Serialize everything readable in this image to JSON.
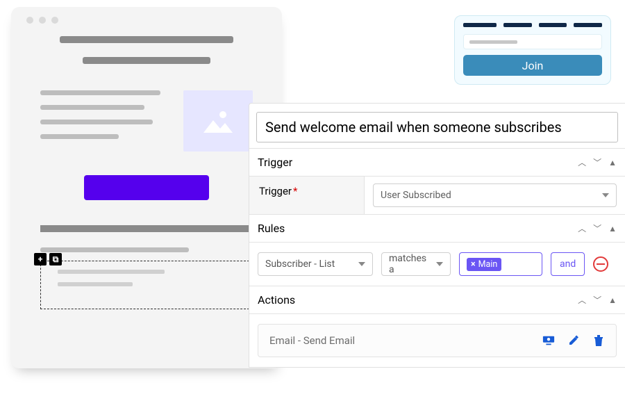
{
  "join_widget": {
    "button_label": "Join"
  },
  "automation": {
    "title_value": "Send welcome email when someone subscribes",
    "trigger_section": {
      "heading": "Trigger",
      "field_label": "Trigger",
      "selected": "User Subscribed"
    },
    "rules_section": {
      "heading": "Rules",
      "field_select": "Subscriber - List",
      "operator_select": "matches a",
      "tag_prefix": "×",
      "tag_label": "Main",
      "and_label": "and"
    },
    "actions_section": {
      "heading": "Actions",
      "item_label": "Email - Send Email"
    }
  }
}
